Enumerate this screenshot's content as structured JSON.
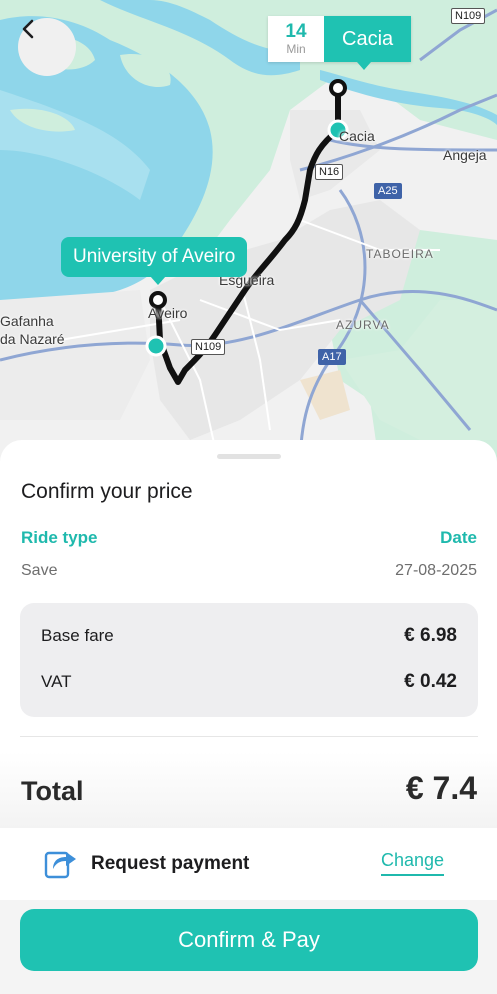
{
  "map": {
    "eta_value": "14",
    "eta_unit": "Min",
    "destination": "Cacia",
    "origin": "University of Aveiro",
    "places": {
      "cacia": "Cacia",
      "angeja": "Angeja",
      "taboeira": "TABOEIRA",
      "esgueira": "Esgueira",
      "azurva": "AZURVA",
      "aveiro": "Aveiro",
      "gafanha_1": "Gafanha",
      "gafanha_2": "da Nazaré"
    },
    "roads": {
      "n109_top": "N109",
      "n16": "N16",
      "a25": "A25",
      "n109_bottom": "N109",
      "a17": "A17"
    },
    "colors": {
      "water": "#8fd6ea",
      "green": "#cfeedd",
      "land": "#f1f1f1",
      "route": "#111111",
      "accent": "#1fc2b2"
    }
  },
  "sheet": {
    "title": "Confirm your price",
    "ride_type_label": "Ride type",
    "ride_type_value": "Save",
    "date_label": "Date",
    "date_value": "27-08-2025",
    "fare": {
      "base_label": "Base fare",
      "base_amount": "€ 6.98",
      "vat_label": "VAT",
      "vat_amount": "€ 0.42"
    },
    "total_label": "Total",
    "total_amount": "€ 7.4",
    "payment_method": "Request payment",
    "change_label": "Change",
    "confirm_label": "Confirm & Pay"
  },
  "icons": {
    "back": "chevron-left-icon",
    "payment": "request-payment-icon"
  }
}
